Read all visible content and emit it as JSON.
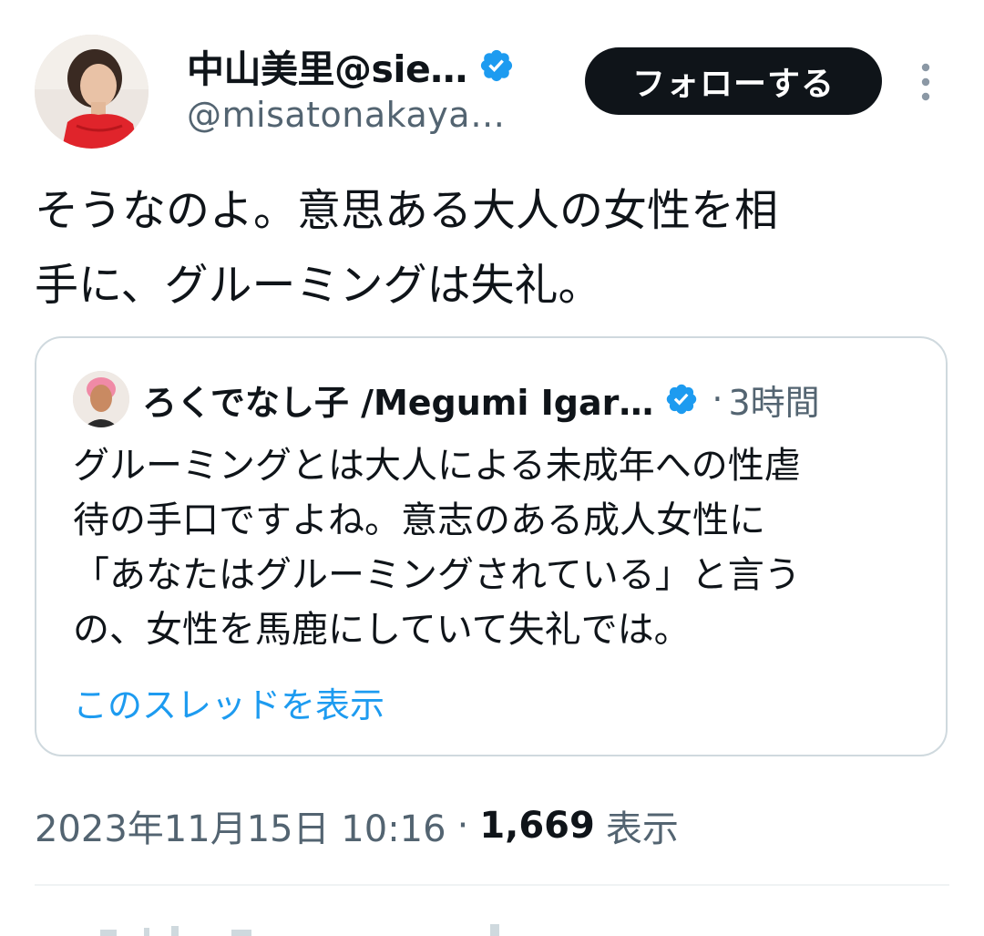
{
  "author": {
    "display_name": "中山美里@sie…",
    "handle": "@misatonakaya…",
    "verified_icon": "verified-badge-icon"
  },
  "follow_button": {
    "label": "フォローする"
  },
  "more_icon": "more-vertical-icon",
  "tweet": {
    "text_line1": "そうなのよ。意思ある大人の女性を相",
    "text_line2": "手に、グルーミングは失礼。"
  },
  "quote": {
    "display_name": "ろくでなし子 /Megumi Igar…",
    "separator": "·",
    "time": "3時間",
    "lines": [
      "グルーミングとは大人による未成年への性虐",
      "待の手口ですよね。意志のある成人女性に",
      "「あなたはグルーミングされている」と言う",
      "の、女性を馬鹿にしていて失礼では。"
    ],
    "thread_link": "このスレッドを表示"
  },
  "meta": {
    "timestamp": "2023年11月15日 10:16",
    "separator": "·",
    "views_count": "1,669",
    "views_label": "表示"
  },
  "colors": {
    "text_primary": "#0f1419",
    "text_secondary": "#536471",
    "link": "#1d9bf0",
    "verified": "#1d9bf0",
    "button_bg": "#0f1419",
    "border": "#cfd9de"
  }
}
